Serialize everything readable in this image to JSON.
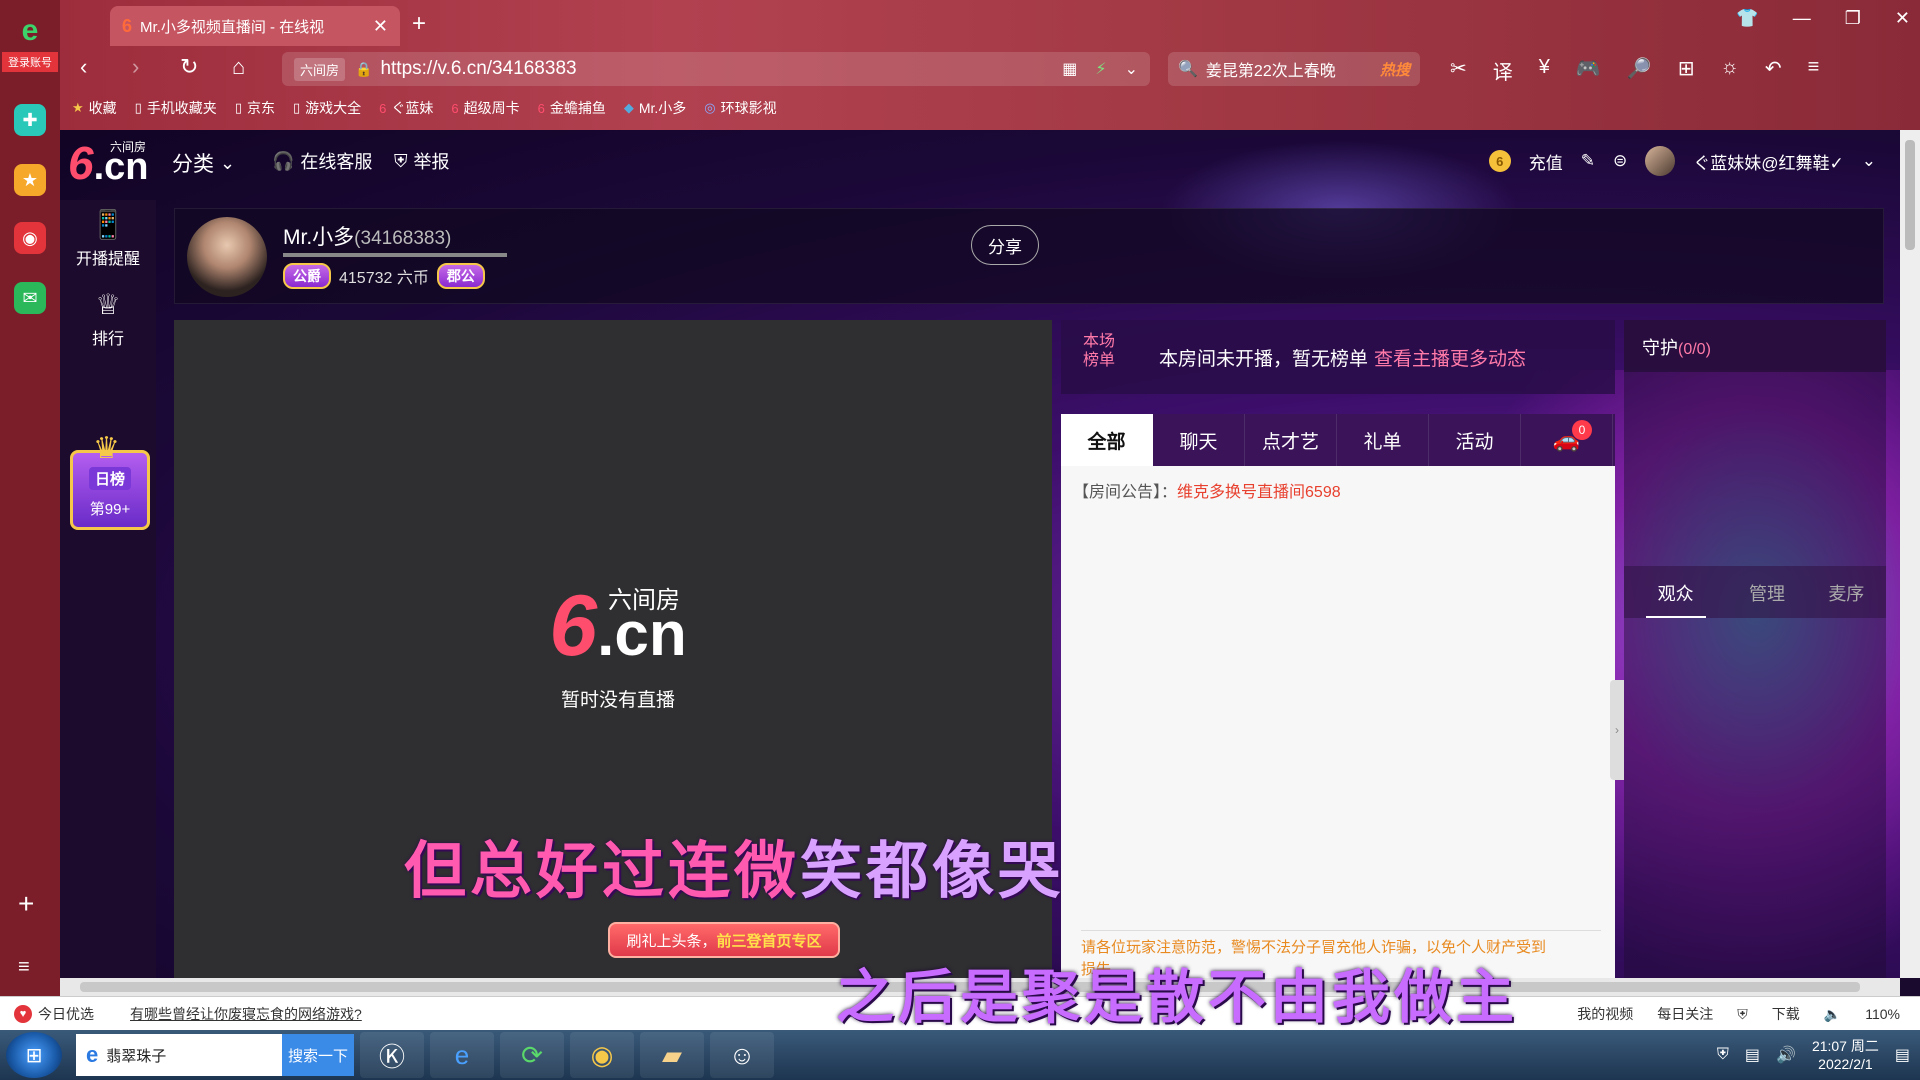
{
  "browser": {
    "tab_title": "Mr.小多视频直播间 - 在线视",
    "tab_favicon": "6",
    "url": "https://v.6.cn/34168383",
    "site_tag": "六间房",
    "search_text": "姜昆第22次上春晚",
    "search_hot": "热搜",
    "zoom": "110%",
    "bookmarks": [
      {
        "label": "收藏",
        "icon": "star-icon"
      },
      {
        "label": "手机收藏夹",
        "icon": "doc-icon"
      },
      {
        "label": "京东",
        "icon": "doc-icon"
      },
      {
        "label": "游戏大全",
        "icon": "doc-icon"
      },
      {
        "label": "ぐ蓝妹",
        "icon": "six-icon"
      },
      {
        "label": "超级周卡",
        "icon": "six-icon"
      },
      {
        "label": "金蟾捕鱼",
        "icon": "six-icon"
      },
      {
        "label": "Mr.小多",
        "icon": "six-icon"
      },
      {
        "label": "环球影视",
        "icon": "globe-icon"
      }
    ]
  },
  "app_sidebar": {
    "login_label": "登录账号"
  },
  "site": {
    "logo_small": "六间房",
    "logo_six": "6",
    "logo_cn": ".cn",
    "nav": {
      "category": "分类",
      "service": "在线客服",
      "report": "举报"
    },
    "header_right": {
      "recharge": "充值",
      "username": "ぐ蓝妹妹@红舞鞋✓"
    },
    "side": {
      "remind": "开播提醒",
      "rank": "排行",
      "daily": "日榜",
      "daily_rank": "第99+"
    }
  },
  "anchor": {
    "name": "Mr.小多",
    "id": "(34168383)",
    "badge1": "公爵",
    "coins": "415732 六币",
    "badge2": "郡公",
    "share": "分享"
  },
  "video": {
    "no_live": "暂时没有直播",
    "lyric_done": "但总好过连微",
    "lyric_rest": "笑都像哭",
    "promo_a": "刷礼上头条，",
    "promo_b": "前三登首页专区"
  },
  "chat": {
    "rank_label": "本场榜单",
    "rank_msg": "本房间未开播，暂无榜单",
    "rank_link": "查看主播更多动态",
    "tabs": [
      "全部",
      "聊天",
      "点才艺",
      "礼单",
      "活动"
    ],
    "car_count": "0",
    "notice_label": "【房间公告】：",
    "notice_text": "维克多换号直播间6598",
    "warn_line1": "请各位玩家注意防范，警惕不法分子冒充他人诈骗，以免个人财产受到",
    "warn_line2": "损失"
  },
  "guard": {
    "title": "守护",
    "count": "(0/0)",
    "tabs": [
      "观众",
      "管理",
      "麦序"
    ]
  },
  "status": {
    "today": "今日优选",
    "news": "有哪些曾经让你废寝忘食的网络游戏?",
    "my_video": "我的视频",
    "daily_focus": "每日关注",
    "download": "下载"
  },
  "lyric2": "之后是聚是散不由我做主",
  "taskbar": {
    "search_text": "翡翠珠子",
    "search_btn": "搜索一下",
    "time": "21:07 周二",
    "date": "2022/2/1"
  }
}
